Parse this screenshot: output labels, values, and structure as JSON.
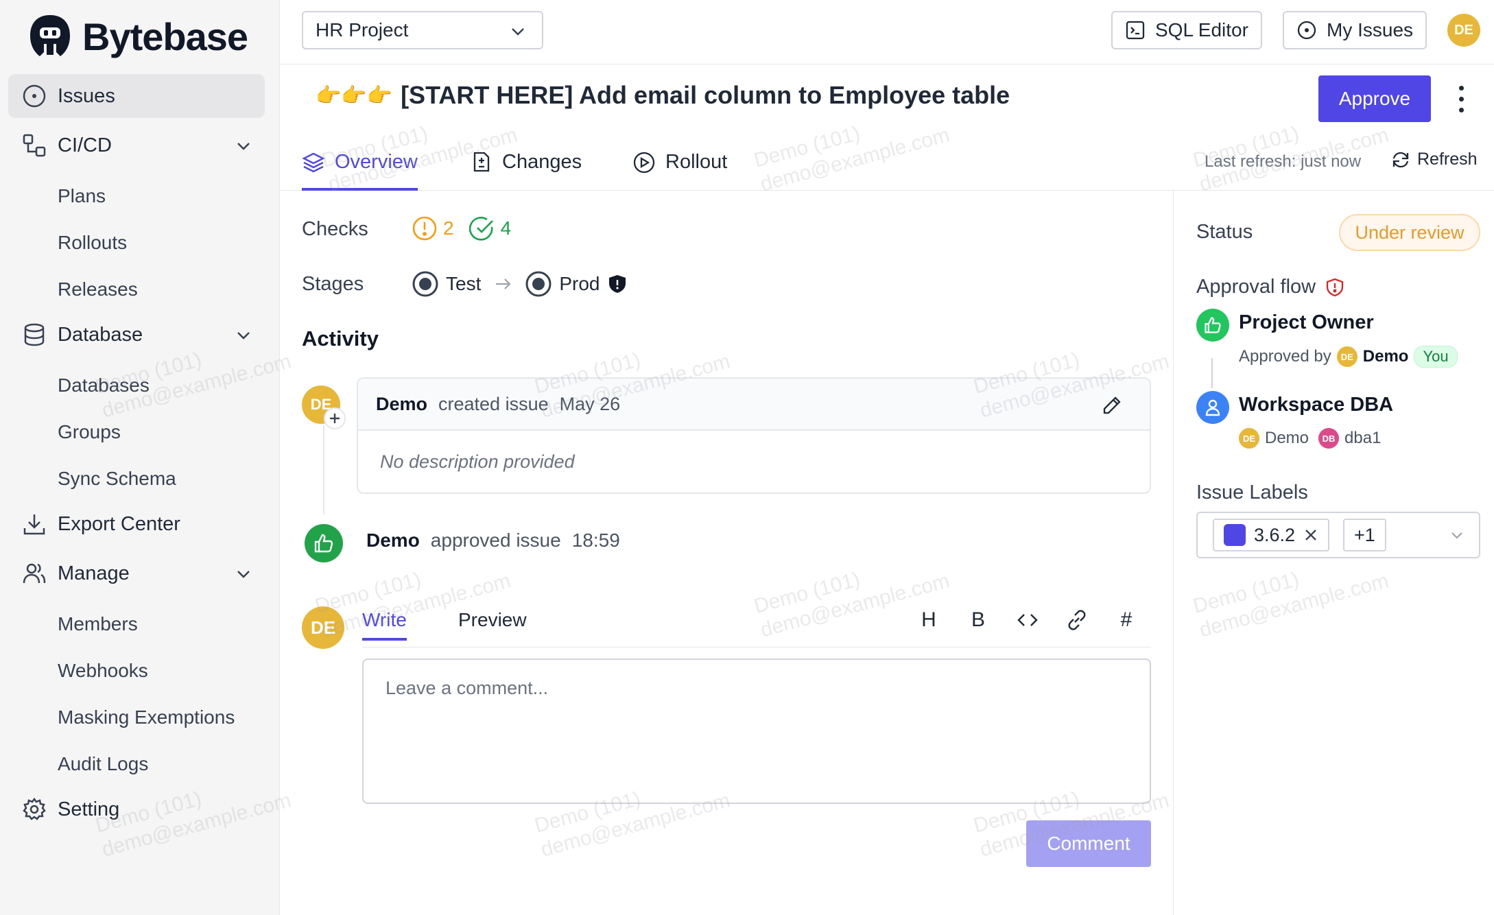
{
  "brand": {
    "name": "Bytebase"
  },
  "sidebar": {
    "issues": "Issues",
    "cicd": "CI/CD",
    "cicd_items": [
      "Plans",
      "Rollouts",
      "Releases"
    ],
    "database": "Database",
    "database_items": [
      "Databases",
      "Groups",
      "Sync Schema"
    ],
    "export_center": "Export Center",
    "manage": "Manage",
    "manage_items": [
      "Members",
      "Webhooks",
      "Masking Exemptions",
      "Audit Logs"
    ],
    "setting": "Setting"
  },
  "topbar": {
    "project": "HR Project",
    "sql_editor": "SQL Editor",
    "my_issues": "My Issues",
    "user_initials": "DE"
  },
  "issue": {
    "emoji": "👉👉👉",
    "title": "[START HERE] Add email column to Employee table",
    "approve_label": "Approve"
  },
  "tabs": {
    "overview": "Overview",
    "changes": "Changes",
    "rollout": "Rollout",
    "last_refresh": "Last refresh: just now",
    "refresh": "Refresh"
  },
  "checks": {
    "label": "Checks",
    "warning_count": "2",
    "success_count": "4"
  },
  "stages": {
    "label": "Stages",
    "items": [
      "Test",
      "Prod"
    ]
  },
  "activity": {
    "heading": "Activity",
    "created": {
      "initials": "DE",
      "actor": "Demo",
      "action": "created issue",
      "time": "May 26",
      "body": "No description provided"
    },
    "approved": {
      "actor": "Demo",
      "action": "approved issue",
      "time": "18:59"
    }
  },
  "editor": {
    "initials": "DE",
    "write": "Write",
    "preview": "Preview",
    "tools": [
      "H",
      "B",
      "<>",
      "link",
      "#"
    ],
    "placeholder": "Leave a comment...",
    "submit": "Comment"
  },
  "panel": {
    "status_label": "Status",
    "status_value": "Under review",
    "approval_flow_label": "Approval flow",
    "steps": [
      {
        "title": "Project Owner",
        "sub": "Approved by",
        "user": "Demo",
        "user_initials": "DE",
        "you": "You"
      },
      {
        "title": "Workspace DBA",
        "users": [
          {
            "initials": "DE",
            "name": "Demo"
          },
          {
            "initials": "DB",
            "name": "dba1"
          }
        ]
      }
    ],
    "labels_label": "Issue Labels",
    "labels": [
      "3.6.2"
    ],
    "labels_more": "+1"
  },
  "watermark": {
    "line1": "Demo (101)",
    "line2": "demo@example.com"
  },
  "colors": {
    "accent": "#4f46e5",
    "success": "#22c55e",
    "warning": "#f59e0b",
    "avatar": "#e7b73a"
  }
}
